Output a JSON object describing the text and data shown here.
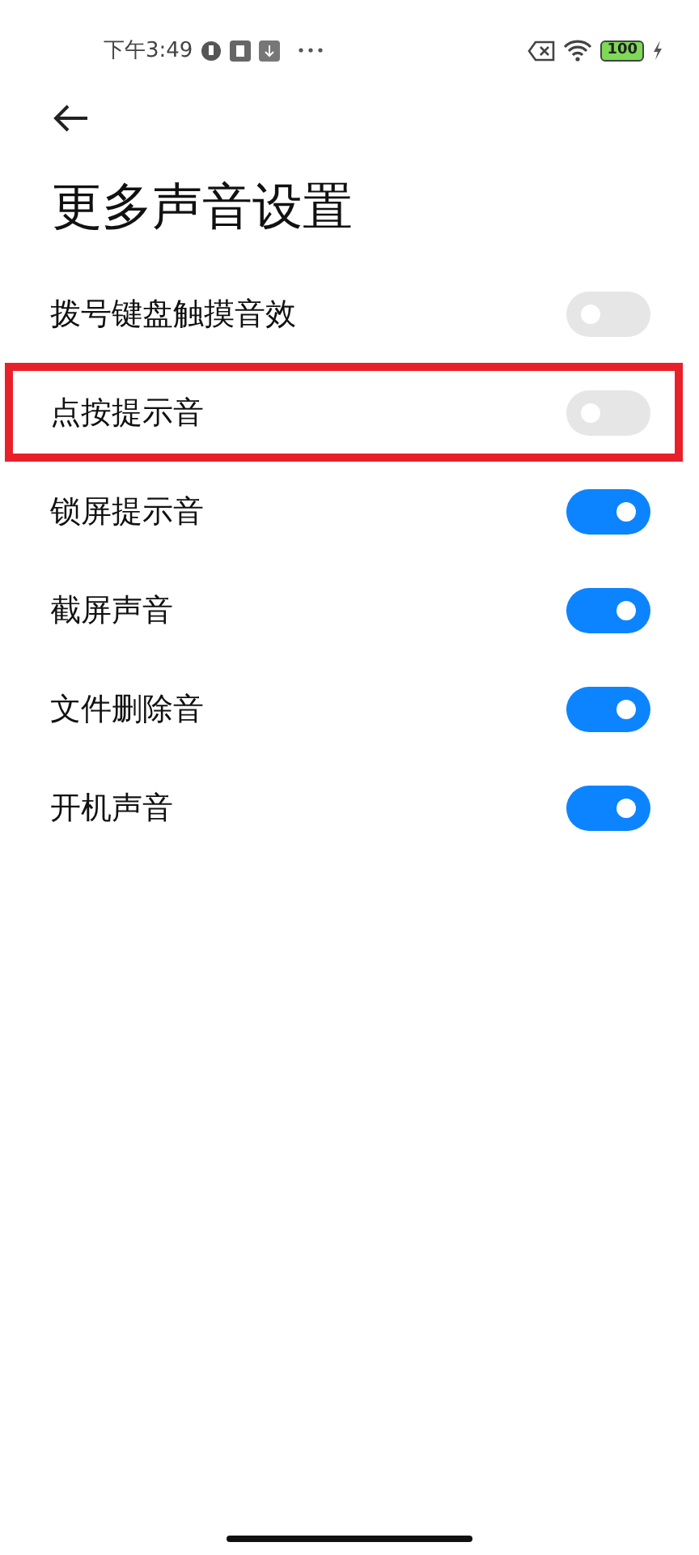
{
  "status_bar": {
    "time": "下午3:49",
    "battery": "100"
  },
  "title": "更多声音设置",
  "settings": [
    {
      "label": "拨号键盘触摸音效",
      "on": false,
      "highlighted": false
    },
    {
      "label": "点按提示音",
      "on": false,
      "highlighted": true
    },
    {
      "label": "锁屏提示音",
      "on": true,
      "highlighted": false
    },
    {
      "label": "截屏声音",
      "on": true,
      "highlighted": false
    },
    {
      "label": "文件删除音",
      "on": true,
      "highlighted": false
    },
    {
      "label": "开机声音",
      "on": true,
      "highlighted": false
    }
  ]
}
